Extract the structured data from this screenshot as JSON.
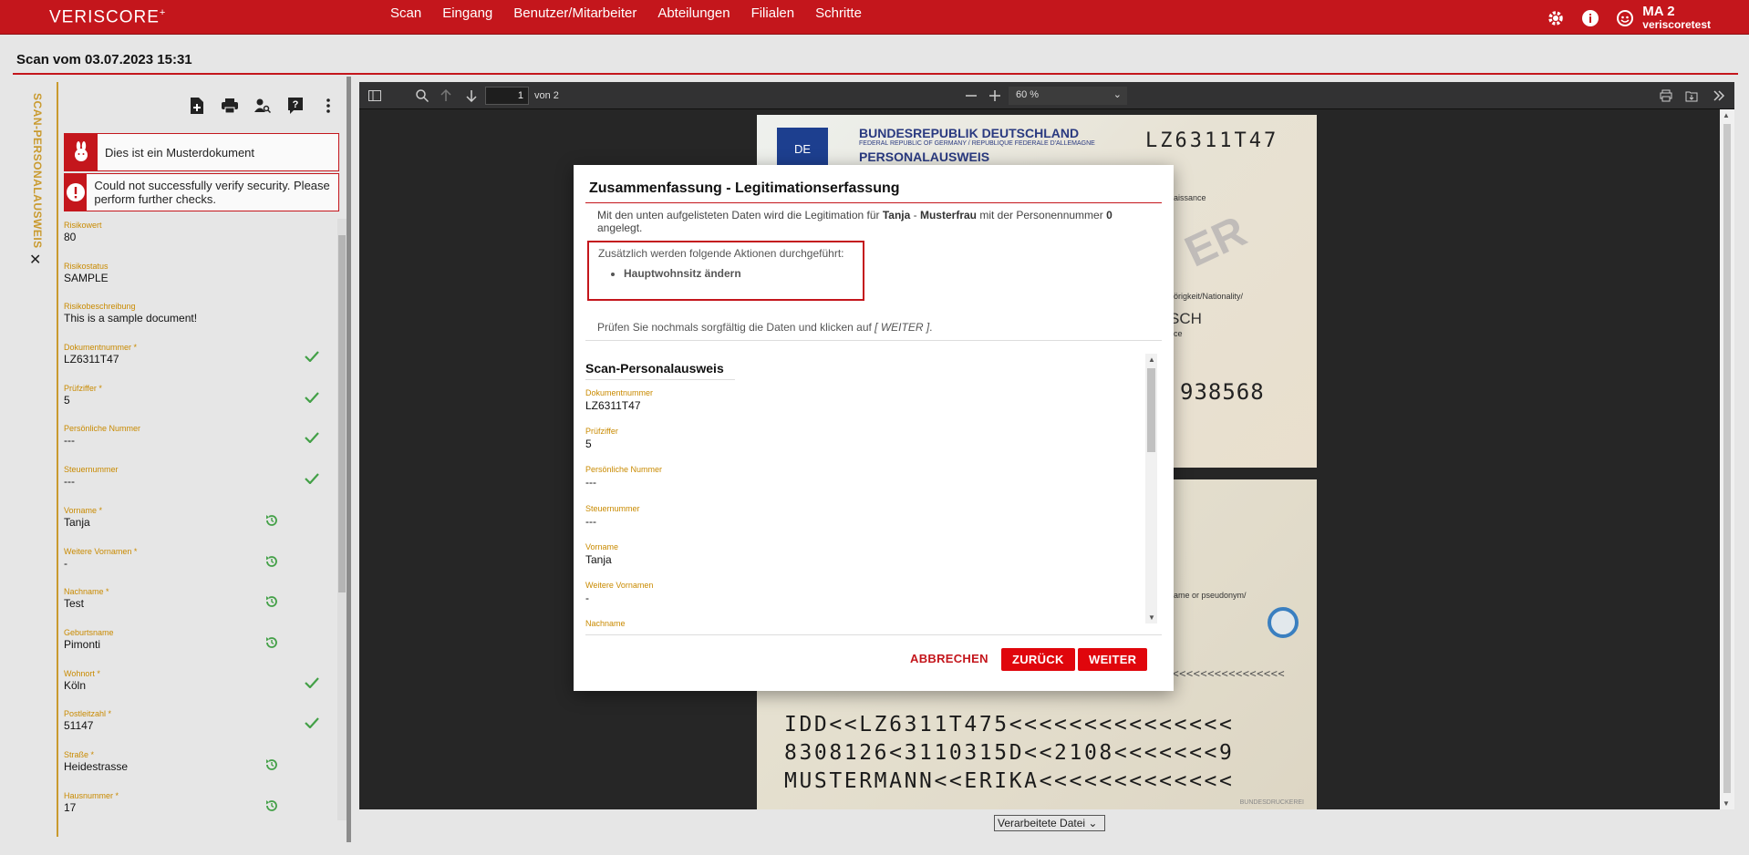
{
  "app": {
    "logo": "VERISCORE",
    "logo_sup": "+",
    "nav": [
      "Scan",
      "Eingang",
      "Benutzer/Mitarbeiter",
      "Abteilungen",
      "Filialen",
      "Schritte"
    ],
    "user_name": "MA 2",
    "user_sub": "veriscoretest"
  },
  "page": {
    "title": "Scan vom 03.07.2023 15:31"
  },
  "left": {
    "tab_label": "SCAN-PERSONALAUSWEIS",
    "tab_close": "✕",
    "alerts": [
      {
        "text": "Dies ist ein Musterdokument",
        "icon": "rabbit-icon"
      },
      {
        "text": "Could not successfully verify security. Please perform further checks.",
        "icon": "exclamation-icon"
      }
    ],
    "fields": [
      {
        "label": "Risikowert",
        "value": "80",
        "mark": ""
      },
      {
        "label": "Risikostatus",
        "value": "SAMPLE",
        "mark": ""
      },
      {
        "label": "Risikobeschreibung",
        "value": "This is a sample document!",
        "mark": ""
      },
      {
        "label": "Dokumentnummer *",
        "value": "LZ6311T47",
        "mark": "check"
      },
      {
        "label": "Prüfziffer *",
        "value": "5",
        "mark": "check"
      },
      {
        "label": "Persönliche Nummer",
        "value": "---",
        "mark": "check"
      },
      {
        "label": "Steuernummer",
        "value": "---",
        "mark": "check"
      },
      {
        "label": "Vorname *",
        "value": "Tanja",
        "mark": "revert"
      },
      {
        "label": "Weitere Vornamen *",
        "value": "-",
        "mark": "revert"
      },
      {
        "label": "Nachname *",
        "value": "Test",
        "mark": "revert"
      },
      {
        "label": "Geburtsname",
        "value": "Pimonti",
        "mark": "revert"
      },
      {
        "label": "Wohnort *",
        "value": "Köln",
        "mark": "check"
      },
      {
        "label": "Postleitzahl *",
        "value": "51147",
        "mark": "check"
      },
      {
        "label": "Straße *",
        "value": "Heidestrasse",
        "mark": "revert"
      },
      {
        "label": "Hausnummer *",
        "value": "17",
        "mark": "revert"
      }
    ]
  },
  "viewer": {
    "page_input": "1",
    "page_of": "von 2",
    "zoom": "60 %",
    "card": {
      "header1": "BUNDESREPUBLIK DEUTSCHLAND",
      "header2": "FEDERAL REPUBLIC OF GERMANY / REPUBLIQUE FEDERALE D'ALLEMAGNE",
      "header3": "PERSONALAUSWEIS",
      "eu": "DE",
      "number": "LZ6311T47",
      "can": "938568",
      "text_naissance": "naissance",
      "text_nationality": "hörigkeit/Nationality/",
      "text_nat_val": "SCH",
      "text_nce": "nce",
      "watermark": "ER",
      "pseudonym": "name or pseudonym/",
      "mrz": [
        "IDD<<LZ6311T475<<<<<<<<<<<<<<<",
        "8308126<3110315D<<2108<<<<<<<9",
        "MUSTERMANN<<ERIKA<<<<<<<<<<<<<"
      ],
      "mrz_fill": "<<<<<<<<<<<<<<<<<<",
      "bdruck": "BUNDESDRUCKEREI"
    },
    "select_value": "Verarbeitete Datei"
  },
  "modal": {
    "title": "Zusammenfassung - Legitimationserfassung",
    "intro_a": "Mit den unten aufgelisteten Daten wird die Legitimation für ",
    "intro_first": "Tanja",
    "intro_dash": " - ",
    "intro_last": "Musterfrau",
    "intro_b": " mit der Personennummer ",
    "intro_num": "0",
    "intro_c": " angelegt.",
    "actions_intro": "Zusätzlich werden folgende Aktionen durchgeführt:",
    "actions": [
      "Hauptwohnsitz ändern"
    ],
    "check_text": "Prüfen Sie nochmals sorgfältig die Daten und klicken auf ",
    "check_button_ref": "[ WEITER ]",
    "check_end": ".",
    "section": "Scan-Personalausweis",
    "fields": [
      {
        "label": "Dokumentnummer",
        "value": "LZ6311T47"
      },
      {
        "label": "Prüfziffer",
        "value": "5"
      },
      {
        "label": "Persönliche Nummer",
        "value": "---"
      },
      {
        "label": "Steuernummer",
        "value": "---"
      },
      {
        "label": "Vorname",
        "value": "Tanja"
      },
      {
        "label": "Weitere Vornamen",
        "value": "-"
      },
      {
        "label": "Nachname",
        "value": ""
      }
    ],
    "btn_cancel": "ABBRECHEN",
    "btn_back": "ZURÜCK",
    "btn_next": "WEITER"
  },
  "colors": {
    "brand": "#c4161c",
    "button": "#e0060c",
    "label": "#c98a00",
    "check": "#43a047"
  }
}
